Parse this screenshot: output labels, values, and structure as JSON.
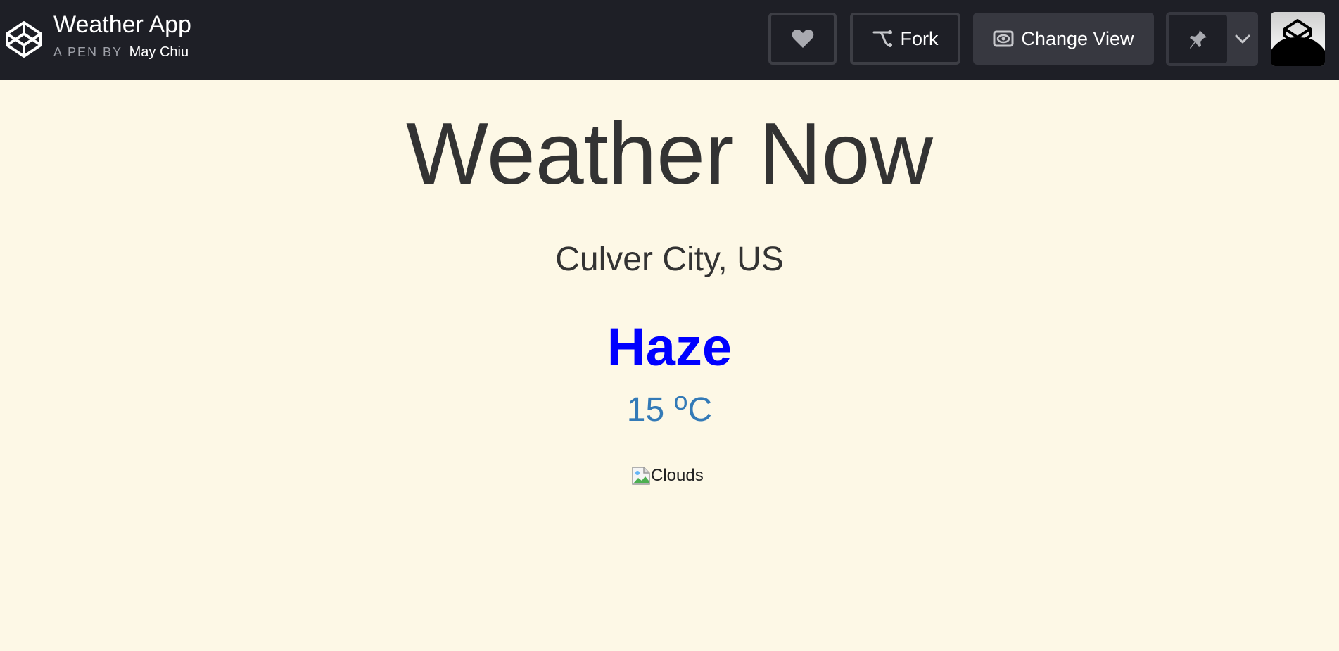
{
  "header": {
    "pen_title": "Weather App",
    "byline_prefix": "A PEN BY",
    "author": "May Chiu",
    "fork_label": "Fork",
    "change_view_label": "Change View",
    "logo_icon": "codepen-logo-icon",
    "heart_icon": "heart-icon",
    "fork_icon": "fork-icon",
    "view_icon": "eye-icon",
    "pin_icon": "pin-icon",
    "caret_icon": "chevron-down-icon"
  },
  "main": {
    "heading": "Weather Now",
    "location": "Culver City, US",
    "condition": "Haze",
    "temperature_value": "15",
    "temperature_degree": "o",
    "temperature_unit": "C",
    "image_alt": "Clouds"
  },
  "colors": {
    "page_background": "#fdf8e6",
    "header_background": "#1e1f26",
    "condition_color": "#0000ff",
    "temperature_color": "#337ab7",
    "text_color": "#333333"
  }
}
